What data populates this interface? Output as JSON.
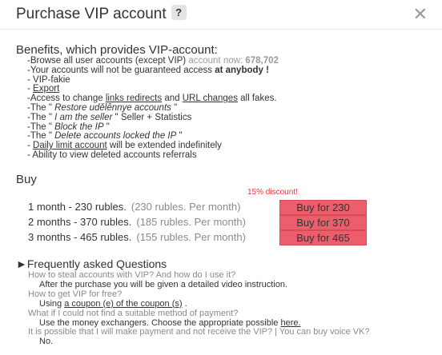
{
  "header": {
    "title": "Purchase VIP account",
    "help_label": "?",
    "close_label": "✕"
  },
  "benefits": {
    "heading": "Benefits, which provides VIP-account:",
    "items": [
      "-Browse all user accounts (except VIP)",
      "account now:",
      "678,702",
      "-Your accounts will not be guaranteed access",
      "at anybody !",
      "- VIP-fakie",
      "- ",
      "Export",
      "-Access to change",
      "links redirects",
      " and ",
      "URL changes",
      " all fakes.",
      "-The \" ",
      "Restore udělênnye accounts",
      " \"",
      "-The \" ",
      "I am the seller",
      " \" Seller + Statistics",
      "-The \" ",
      "Block the IP",
      " \"",
      "-The \" ",
      "Delete accounts locked the IP",
      " \"",
      "- ",
      "Daily limit account",
      " will be extended indefinitely",
      "- Ability to view deleted accounts referrals"
    ]
  },
  "buy": {
    "heading": "Buy",
    "discount": "15% discount!",
    "plans": [
      {
        "label": "1 month - 230 rubles.",
        "per": "(230 rubles. Per month)",
        "button": "Buy for 230"
      },
      {
        "label": "2 months - 370 rubles.",
        "per": "(185 rubles. Per month)",
        "button": "Buy for 370"
      },
      {
        "label": "3 months - 465 rubles.",
        "per": "(155 rubles. Per month)",
        "button": "Buy for 465"
      }
    ]
  },
  "faq": {
    "heading": "►Frequently asked Questions",
    "q1": "How to steal accounts with VIP? And how do I use it?",
    "a1": "After the purchase you will be given a detailed video instruction.",
    "q2": "How to get VIP for free?",
    "a2_prefix": "Using ",
    "a2_link": "a coupon (e) of the coupon (s)",
    "a2_suffix": " .",
    "q3": "What if I could not find a suitable method of payment?",
    "a3_prefix": "Use the money exchangers. Choose the appropriate possible ",
    "a3_link": "here.",
    "q4": "It is possible that I will make payment and not receive the VIP? | You can buy voice VK?",
    "a4": "No."
  },
  "colors": {
    "button_bg": "#ea5f6b",
    "discount": "#e53935"
  }
}
